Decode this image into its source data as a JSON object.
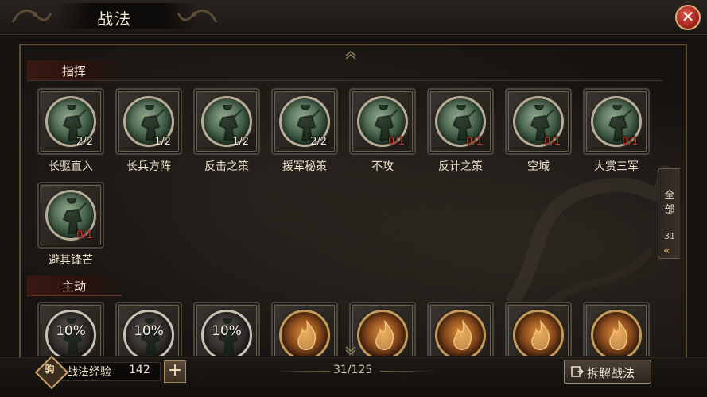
{
  "header": {
    "title": "战法",
    "close_icon": "close-icon"
  },
  "sections": [
    {
      "id": "command",
      "label": "指挥"
    },
    {
      "id": "active",
      "label": "主动"
    }
  ],
  "command_skills": [
    {
      "name": "长驱直入",
      "count": "2/2",
      "empty": false
    },
    {
      "name": "长兵方阵",
      "count": "1/2",
      "empty": false
    },
    {
      "name": "反击之策",
      "count": "1/2",
      "empty": false
    },
    {
      "name": "援军秘策",
      "count": "2/2",
      "empty": false
    },
    {
      "name": "不攻",
      "count": "0/1",
      "empty": true
    },
    {
      "name": "反计之策",
      "count": "0/1",
      "empty": true
    },
    {
      "name": "空城",
      "count": "0/1",
      "empty": true
    },
    {
      "name": "大赏三军",
      "count": "0/1",
      "empty": true
    },
    {
      "name": "避其锋芒",
      "count": "0/1",
      "empty": true
    }
  ],
  "active_skills": [
    {
      "progress": "10%",
      "style": "gray"
    },
    {
      "progress": "10%",
      "style": "gray"
    },
    {
      "progress": "10%",
      "style": "gray"
    },
    {
      "progress": "",
      "style": "gold"
    },
    {
      "progress": "",
      "style": "gold"
    },
    {
      "progress": "",
      "style": "gold"
    },
    {
      "progress": "",
      "style": "gold"
    },
    {
      "progress": "",
      "style": "gold"
    }
  ],
  "side_filter": {
    "label_line1": "全",
    "label_line2": "部",
    "count": "31",
    "chevron": "«"
  },
  "footer": {
    "exp_icon_text": "驹",
    "exp_label": "战法经验",
    "exp_value": "142",
    "plus": "+",
    "page_count": "31/125",
    "dismantle_label": "拆解战法"
  },
  "colors": {
    "accent_gold": "#c8a066",
    "empty_count_red": "#d8362a",
    "close_red": "#9a1e18"
  }
}
